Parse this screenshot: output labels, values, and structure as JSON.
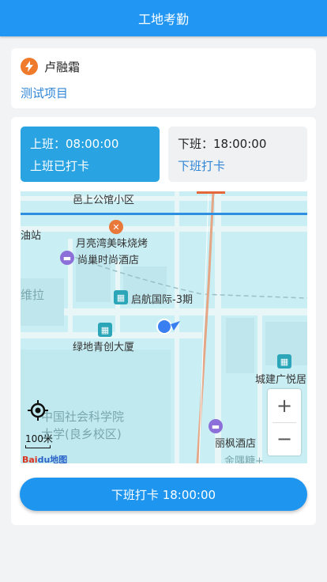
{
  "header": {
    "title": "工地考勤"
  },
  "user": {
    "name": "卢融霜",
    "project": "测试项目"
  },
  "shifts": {
    "on": {
      "time_label": "上班：08:00:00",
      "status": "上班已打卡"
    },
    "off": {
      "time_label": "下班：18:00:00",
      "status": "下班打卡"
    }
  },
  "map": {
    "labels": [
      "邑上公馆小区",
      "油站",
      "月亮湾美味烧烤",
      "尚巢时尚酒店",
      "维拉",
      "启航国际-3期",
      "绿地青创大厦",
      "城建广悦居",
      "中国社会科学院",
      "大学(良乡校区)",
      "丽枫酒店",
      "金隅糖+"
    ],
    "zoom_in": "+",
    "zoom_out": "−",
    "scale": "100米",
    "logo_text": "Bai",
    "logo_text2": "du地图"
  },
  "action": {
    "punch_button": "下班打卡 18:00:00"
  },
  "colors": {
    "primary": "#2196f3",
    "shift_active": "#29a3e1",
    "link": "#2f86d6",
    "accent": "#f07a2c"
  }
}
